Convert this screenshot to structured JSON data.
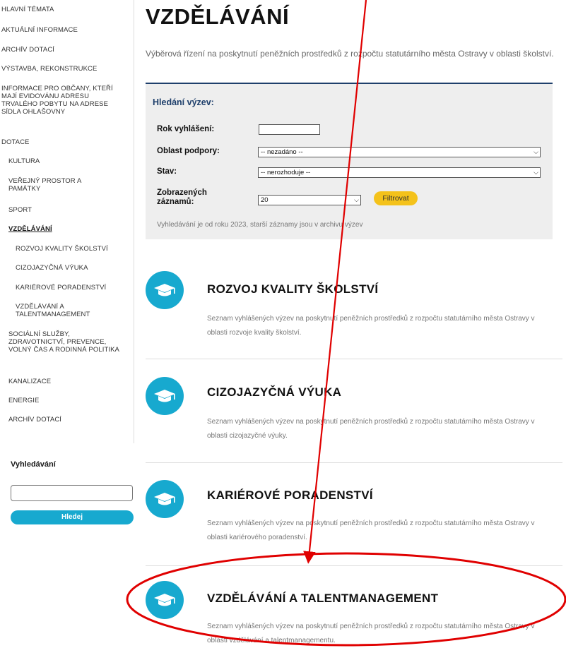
{
  "sidebar": {
    "items": [
      {
        "label": "HLAVNÍ TÉMATA"
      },
      {
        "label": "AKTUÁLNÍ INFORMACE"
      },
      {
        "label": "ARCHÍV DOTACÍ"
      },
      {
        "label": "VÝSTAVBA, REKONSTRUKCE"
      },
      {
        "label": "INFORMACE PRO OBČANY, KTEŘÍ MAJÍ EVIDOVÁNU ADRESU TRVALÉHO POBYTU NA ADRESE SÍDLA OHLAŠOVNY"
      },
      {
        "label": "DOTACE"
      },
      {
        "label": "KULTURA"
      },
      {
        "label": "VEŘEJNÝ PROSTOR A PAMÁTKY"
      },
      {
        "label": "SPORT"
      },
      {
        "label": "VZDĚLÁVÁNÍ"
      },
      {
        "label": "ROZVOJ KVALITY ŠKOLSTVÍ"
      },
      {
        "label": "CIZOJAZYČNÁ VÝUKA"
      },
      {
        "label": "KARIÉROVÉ PORADENSTVÍ"
      },
      {
        "label": "VZDĚLÁVÁNÍ A TALENTMANAGEMENT"
      },
      {
        "label": "SOCIÁLNÍ SLUŽBY, ZDRAVOTNICTVÍ, PREVENCE, VOLNÝ ČAS A RODINNÁ POLITIKA"
      },
      {
        "label": "KANALIZACE"
      },
      {
        "label": "ENERGIE"
      },
      {
        "label": "ARCHÍV DOTACÍ"
      }
    ]
  },
  "search": {
    "title": "Vyhledávání",
    "input_value": "",
    "button_label": "Hledej"
  },
  "main": {
    "title": "VZDĚLÁVÁNÍ",
    "intro": "Výběrová řízení na poskytnutí peněžních prostředků z rozpočtu statutárního města Ostravy v oblasti školství."
  },
  "filter": {
    "title": "Hledání výzev:",
    "year_label": "Rok vyhlášení:",
    "year_value": "",
    "area_label": "Oblast podpory:",
    "area_value": "-- nezadáno --",
    "state_label": "Stav:",
    "state_value": "-- nerozhoduje --",
    "count_label": "Zobrazených záznamů:",
    "count_value": "20",
    "button_label": "Filtrovat",
    "note": "Vyhledávání je od roku 2023, starší záznamy jsou v archivu výzev"
  },
  "categories": [
    {
      "title": "ROZVOJ KVALITY ŠKOLSTVÍ",
      "description": "Seznam vyhlášených výzev na poskytnutí peněžních prostředků z rozpočtu statutárního města Ostravy v oblasti rozvoje kvality školství."
    },
    {
      "title": "CIZOJAZYČNÁ VÝUKA",
      "description": "Seznam vyhlášených výzev na poskytnutí peněžních prostředků z rozpočtu statutárního města Ostravy v oblasti cizojazyčné výuky."
    },
    {
      "title": "KARIÉROVÉ PORADENSTVÍ",
      "description": "Seznam vyhlášených výzev na poskytnutí peněžních prostředků z rozpočtu statutárního města Ostravy v oblasti kariérového poradenství."
    },
    {
      "title": "VZDĚLÁVÁNÍ A TALENTMANAGEMENT",
      "description": "Seznam vyhlášených výzev na poskytnutí peněžních prostředků z rozpočtu statutárního města Ostravy v oblasti vzdělávání a talentmanagementu."
    }
  ],
  "annotation": {
    "icons": [
      "arrow-annotation",
      "ellipse-annotation"
    ],
    "color": "#e00000"
  },
  "colors": {
    "accent": "#17a9cf",
    "filter_button": "#f4c21b",
    "filter_heading": "#1e3f6b"
  }
}
